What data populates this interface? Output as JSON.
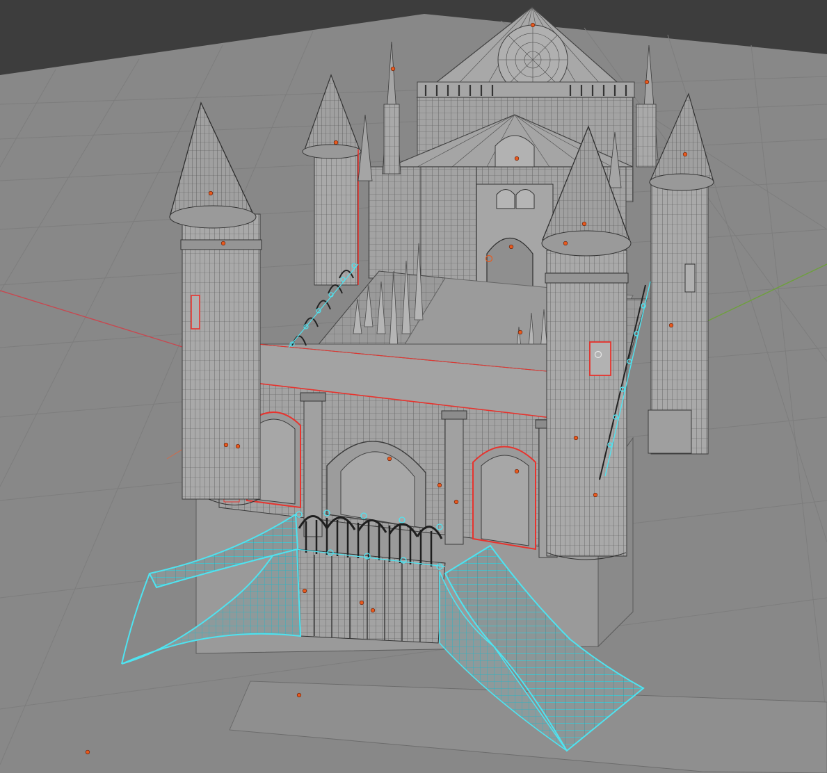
{
  "viewport": {
    "view": "3d-viewport-perspective",
    "shading": "solid-with-wireframe-overlay",
    "background_color": "#3d3d3d",
    "grid_floor_color": "#888888",
    "grid_line_color": "#7a7a7a",
    "axis_x_color": "#c8474f",
    "axis_y_color": "#6ea03c",
    "mesh_color": "#9c9c9c",
    "mesh_light_color": "#b2b2b2",
    "mesh_dark_color": "#7e7e7e",
    "wire_color": "#3c3c3c",
    "selected_active_color": "#4fe3f0",
    "selected_edge_color": "#e8332d",
    "origin_point_color": "#e85a1e"
  },
  "scene": {
    "object": "castle-model",
    "visible_text": []
  }
}
